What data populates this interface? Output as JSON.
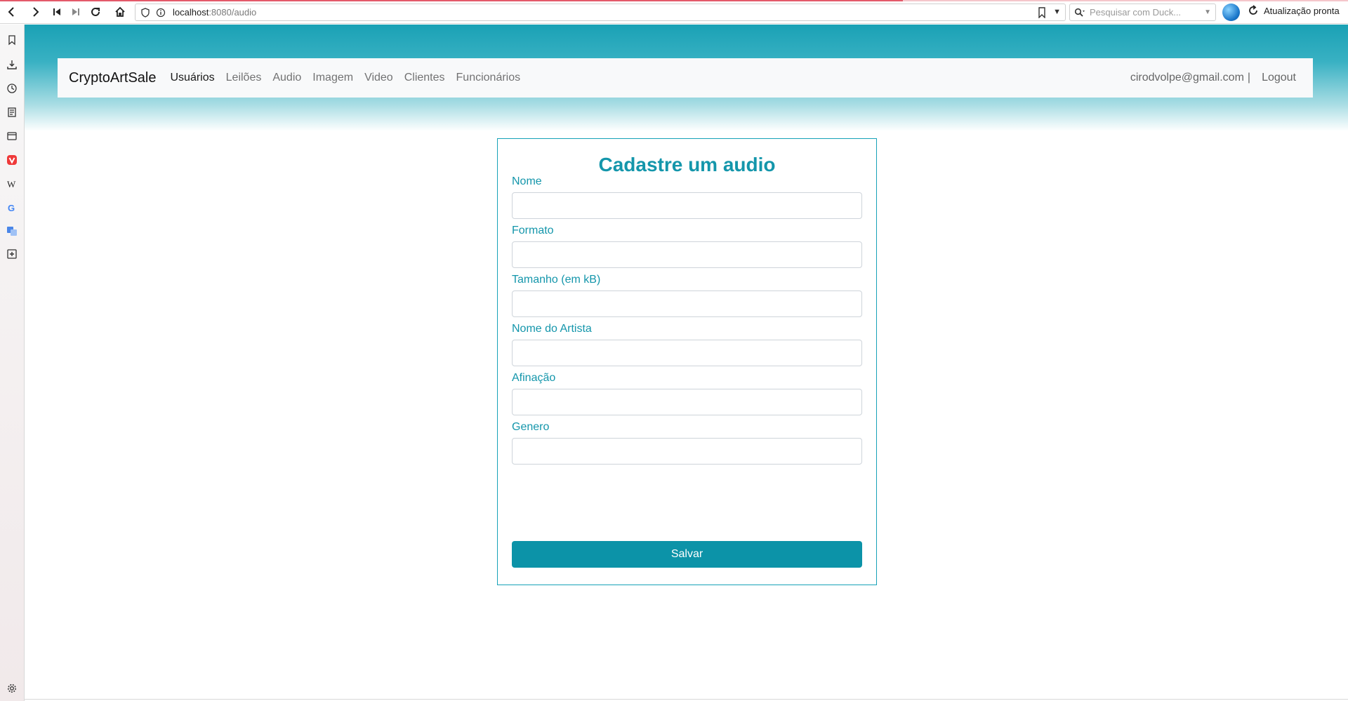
{
  "browser": {
    "url_host": "localhost",
    "url_path": ":8080/audio",
    "search_placeholder": "Pesquisar com Duck...",
    "update_label": "Atualização pronta",
    "load_progress": 0.67
  },
  "navbar": {
    "brand": "CryptoArtSale",
    "links": [
      {
        "label": "Usuários",
        "active": true
      },
      {
        "label": "Leilões",
        "active": false
      },
      {
        "label": "Audio",
        "active": false
      },
      {
        "label": "Imagem",
        "active": false
      },
      {
        "label": "Video",
        "active": false
      },
      {
        "label": "Clientes",
        "active": false
      },
      {
        "label": "Funcionários",
        "active": false
      }
    ],
    "user_email": "cirodvolpe@gmail.com",
    "separator": "|",
    "logout": "Logout"
  },
  "form": {
    "title": "Cadastre um audio",
    "fields": [
      {
        "label": "Nome",
        "value": ""
      },
      {
        "label": "Formato",
        "value": ""
      },
      {
        "label": "Tamanho (em kB)",
        "value": ""
      },
      {
        "label": "Nome do Artista",
        "value": ""
      },
      {
        "label": "Afinação",
        "value": ""
      },
      {
        "label": "Genero",
        "value": ""
      }
    ],
    "submit_label": "Salvar"
  },
  "colors": {
    "accent": "#17a2b8",
    "button": "#0c93a8",
    "hero_top": "#1aa1b5"
  },
  "sidepanel_icons": [
    "bookmark-icon",
    "download-icon",
    "history-icon",
    "notes-icon",
    "window-icon",
    "vivaldi-icon",
    "wikipedia-icon",
    "google-icon",
    "translate-icon",
    "add-panel-icon",
    "settings-icon"
  ]
}
